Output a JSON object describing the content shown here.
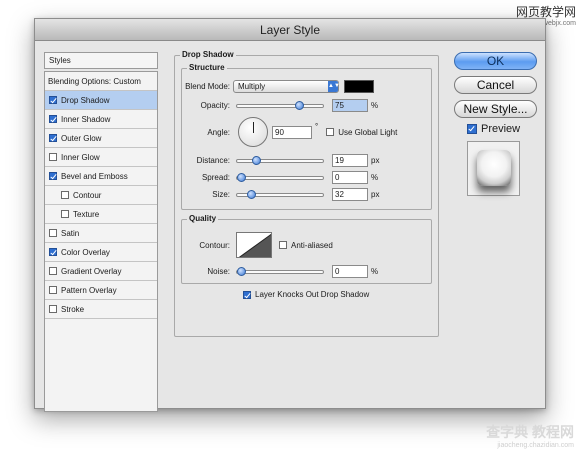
{
  "window": {
    "title": "Layer Style"
  },
  "watermark_top": {
    "line1": "网页教学网",
    "line2": "www.webjx.com"
  },
  "watermark_bottom": {
    "line1": "查字典 教程网",
    "line2": "jiaocheng.chazidian.com"
  },
  "styles": {
    "header": "Styles",
    "blending": "Blending Options: Custom",
    "items": [
      {
        "label": "Drop Shadow",
        "checked": true,
        "selected": true,
        "indent": false
      },
      {
        "label": "Inner Shadow",
        "checked": true,
        "selected": false,
        "indent": false
      },
      {
        "label": "Outer Glow",
        "checked": true,
        "selected": false,
        "indent": false
      },
      {
        "label": "Inner Glow",
        "checked": false,
        "selected": false,
        "indent": false
      },
      {
        "label": "Bevel and Emboss",
        "checked": true,
        "selected": false,
        "indent": false
      },
      {
        "label": "Contour",
        "checked": false,
        "selected": false,
        "indent": true
      },
      {
        "label": "Texture",
        "checked": false,
        "selected": false,
        "indent": true
      },
      {
        "label": "Satin",
        "checked": false,
        "selected": false,
        "indent": false
      },
      {
        "label": "Color Overlay",
        "checked": true,
        "selected": false,
        "indent": false
      },
      {
        "label": "Gradient Overlay",
        "checked": false,
        "selected": false,
        "indent": false
      },
      {
        "label": "Pattern Overlay",
        "checked": false,
        "selected": false,
        "indent": false
      },
      {
        "label": "Stroke",
        "checked": false,
        "selected": false,
        "indent": false
      }
    ]
  },
  "drop_shadow": {
    "title": "Drop Shadow",
    "structure": {
      "title": "Structure",
      "blend_mode_label": "Blend Mode:",
      "blend_mode_value": "Multiply",
      "shadow_color": "#000000",
      "opacity_label": "Opacity:",
      "opacity_value": "75",
      "opacity_level": 0.75,
      "angle_label": "Angle:",
      "angle_value": "90",
      "angle_unit": "°",
      "global_light_label": "Use Global Light",
      "global_light_checked": false,
      "distance_label": "Distance:",
      "distance_value": "19",
      "distance_level": 0.19,
      "spread_label": "Spread:",
      "spread_value": "0",
      "spread_level": 0.0,
      "size_label": "Size:",
      "size_value": "32",
      "size_level": 0.13,
      "unit_pct": "%",
      "unit_px": "px"
    },
    "quality": {
      "title": "Quality",
      "contour_label": "Contour:",
      "anti_aliased_label": "Anti-aliased",
      "anti_aliased_checked": false,
      "noise_label": "Noise:",
      "noise_value": "0",
      "noise_level": 0.0,
      "unit_pct": "%"
    },
    "knockout_label": "Layer Knocks Out Drop Shadow",
    "knockout_checked": true
  },
  "buttons": {
    "ok": "OK",
    "cancel": "Cancel",
    "new_style": "New Style..."
  },
  "preview": {
    "label": "Preview",
    "checked": true
  },
  "colors": {
    "accent": "#3a78d4",
    "selected_row": "#b4cef0",
    "dialog_bg": "#e6e6e6"
  }
}
